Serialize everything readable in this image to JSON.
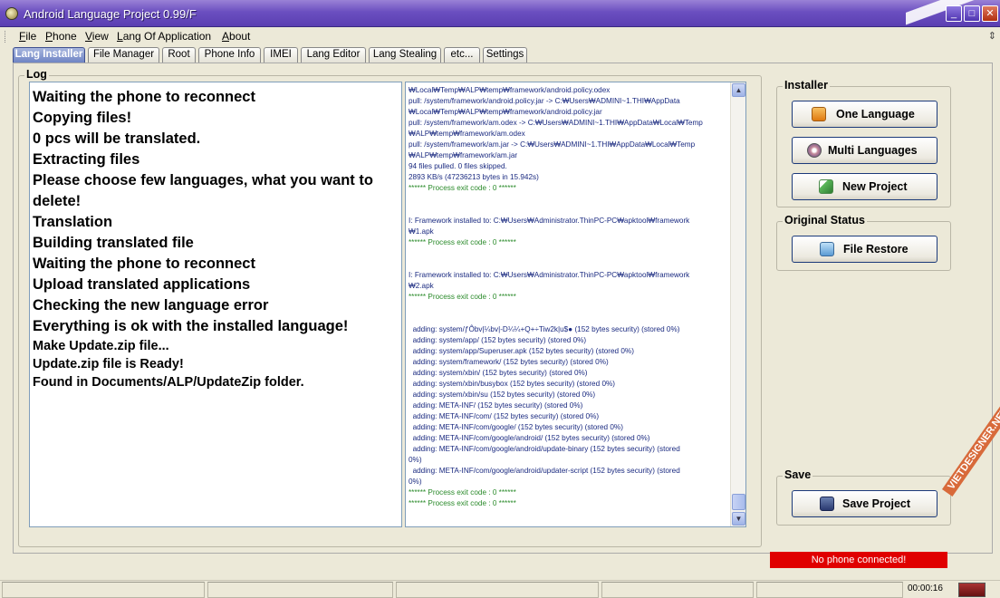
{
  "window": {
    "title": "Android Language Project 0.99/F"
  },
  "menu": [
    "File",
    "Phone",
    "View",
    "Lang Of Application",
    "About"
  ],
  "menu_underline": [
    "F",
    "P",
    "V",
    "L",
    "A"
  ],
  "tabs": [
    "Lang Installer",
    "File Manager",
    "Root",
    "Phone Info",
    "IMEI",
    "Lang Editor",
    "Lang Stealing",
    "etc...",
    "Settings"
  ],
  "active_tab": "Lang Installer",
  "log": {
    "title": "Log",
    "lines": [
      "Waiting the phone to reconnect",
      "Copying files!",
      "0 pcs will be translated.",
      "Extracting files",
      "Please choose few languages, what you want to delete!",
      "Translation",
      "Building translated file",
      "Waiting the phone to reconnect",
      "Upload translated applications",
      "Checking the new language error",
      "Everything is ok with the installed language!",
      "Make Update.zip file...",
      "Update.zip file is Ready!",
      "Found in Documents/ALP/UpdateZip folder."
    ],
    "raw": [
      "₩Local₩Temp₩ALP₩temp₩framework/android.policy.odex",
      "pull: /system/framework/android.policy.jar -> C:₩Users₩ADMINI~1.THI₩AppData",
      "₩Local₩Temp₩ALP₩temp₩framework/android.policy.jar",
      "pull: /system/framework/am.odex -> C:₩Users₩ADMINI~1.THI₩AppData₩Local₩Temp",
      "₩ALP₩temp₩framework/am.odex",
      "pull: /system/framework/am.jar -> C:₩Users₩ADMINI~1.THI₩AppData₩Local₩Temp",
      "₩ALP₩temp₩framework/am.jar",
      "94 files pulled. 0 files skipped.",
      "2893 KB/s (47236213 bytes in 15.942s)",
      "****** Process exit code : 0 ******",
      "",
      "",
      "I: Framework installed to: C:₩Users₩Administrator.ThinPC-PC₩apktool₩framework",
      "₩1.apk",
      "****** Process exit code : 0 ******",
      "",
      "",
      "I: Framework installed to: C:₩Users₩Administrator.ThinPC-PC₩apktool₩framework",
      "₩2.apk",
      "****** Process exit code : 0 ******",
      "",
      "",
      "  adding: system/ƒÔbv|¼bv|-D¼¼+Q+÷Tiw2k|u$● (152 bytes security) (stored 0%)",
      "  adding: system/app/ (152 bytes security) (stored 0%)",
      "  adding: system/app/Superuser.apk (152 bytes security) (stored 0%)",
      "  adding: system/framework/ (152 bytes security) (stored 0%)",
      "  adding: system/xbin/ (152 bytes security) (stored 0%)",
      "  adding: system/xbin/busybox (152 bytes security) (stored 0%)",
      "  adding: system/xbin/su (152 bytes security) (stored 0%)",
      "  adding: META-INF/ (152 bytes security) (stored 0%)",
      "  adding: META-INF/com/ (152 bytes security) (stored 0%)",
      "  adding: META-INF/com/google/ (152 bytes security) (stored 0%)",
      "  adding: META-INF/com/google/android/ (152 bytes security) (stored 0%)",
      "  adding: META-INF/com/google/android/update-binary (152 bytes security) (stored",
      "0%)",
      "  adding: META-INF/com/google/android/updater-script (152 bytes security) (stored",
      "0%)",
      "****** Process exit code : 0 ******",
      "****** Process exit code : 0 ******"
    ]
  },
  "installer": {
    "title": "Installer",
    "buttons": [
      "One Language",
      "Multi Languages",
      "New Project"
    ]
  },
  "original_status": {
    "title": "Original Status",
    "button": "File Restore"
  },
  "save": {
    "title": "Save",
    "button": "Save Project"
  },
  "status": {
    "phone": "No phone connected!",
    "clock": "00:00:16"
  },
  "watermark": "VIETDESIGNER.NET",
  "colors": {
    "accent": "#5a3fb2",
    "status_red": "#e00000",
    "log_blue": "#1a2a80",
    "exit_green": "#2a8a2a"
  }
}
